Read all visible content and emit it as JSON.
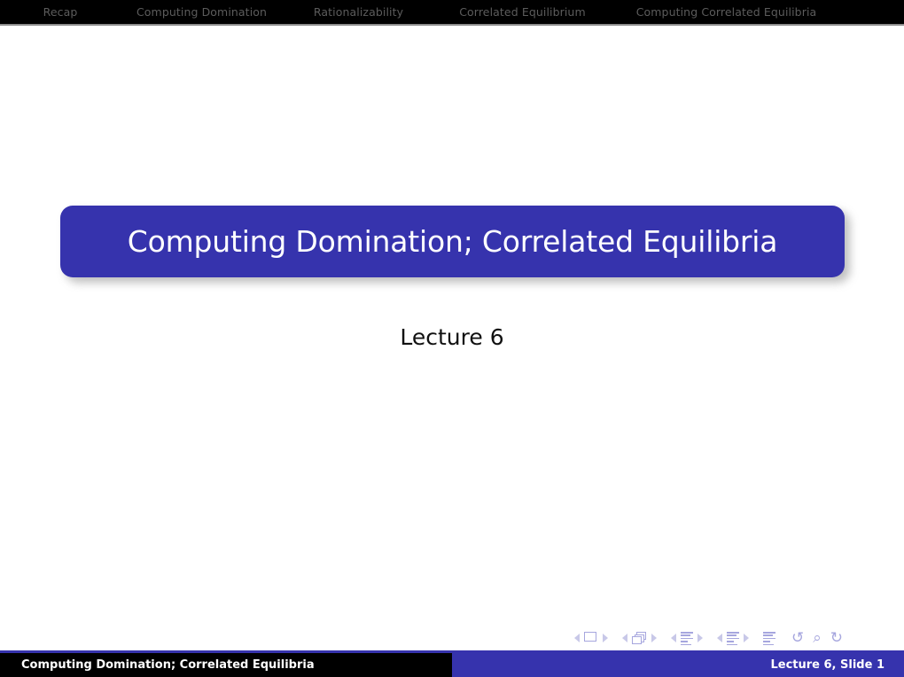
{
  "deck": {
    "title": "Computing Domination; Correlated Equilibria",
    "subtitle": "Lecture 6"
  },
  "navbar": {
    "items": [
      {
        "label": "Recap",
        "active": false
      },
      {
        "label": "Computing Domination",
        "active": false
      },
      {
        "label": "Rationalizability",
        "active": false
      },
      {
        "label": "Correlated Equilibrium",
        "active": false
      },
      {
        "label": "Computing Correlated Equilibria",
        "active": false
      }
    ]
  },
  "nav_symbols": {
    "groups": [
      {
        "name": "slide",
        "prev": "◀",
        "icon": "slide-icon",
        "next": "▶"
      },
      {
        "name": "frame",
        "prev": "◀",
        "icon": "frame-icon",
        "next": "▶"
      },
      {
        "name": "subsection",
        "prev": "◀",
        "icon": "subsection-icon",
        "next": "▶"
      },
      {
        "name": "section",
        "prev": "◀",
        "icon": "section-icon",
        "next": "▶"
      },
      {
        "name": "presentation",
        "icon": "presentation-icon"
      }
    ],
    "back": "↺",
    "search": "⌕",
    "forward": "↻"
  },
  "footer": {
    "left": "Computing Domination; Correlated Equilibria",
    "right": "Lecture 6, Slide 1"
  },
  "colors": {
    "accent": "#3633ad",
    "navbar_bg": "#000000",
    "navbar_text": "#5c5c5c",
    "title_text": "#ffffff",
    "body_bg": "#ffffff",
    "nav_symbol": "#a6a6de"
  }
}
